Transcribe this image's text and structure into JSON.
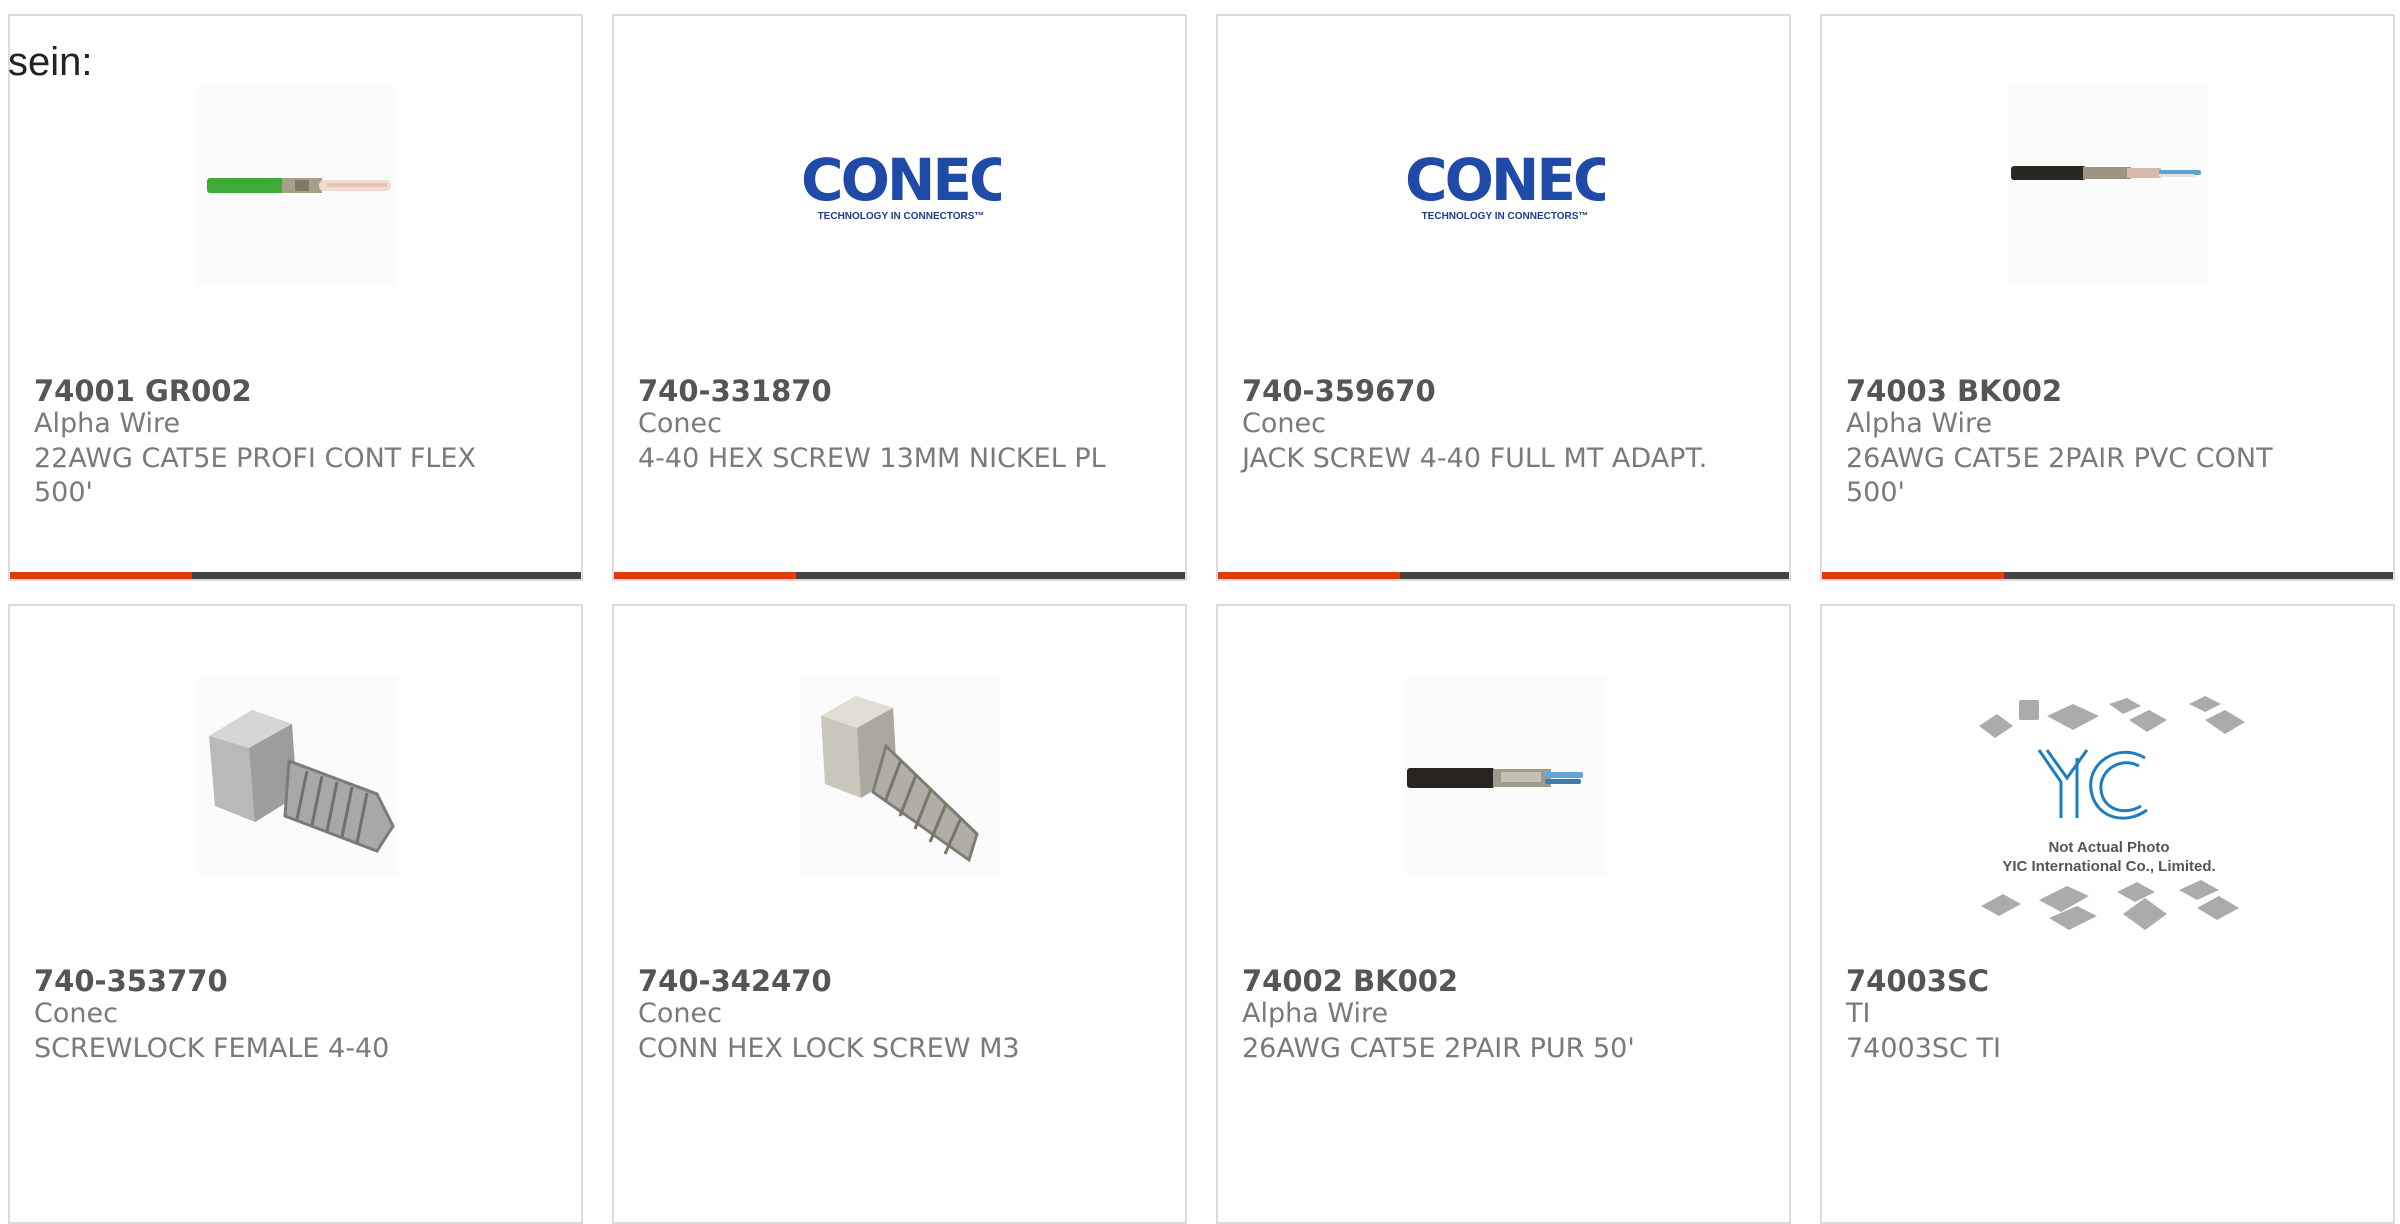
{
  "intro_text": "sein:",
  "products": [
    {
      "part": "74001 GR002",
      "maker": "Alpha Wire",
      "desc": "22AWG CAT5E PROFI CONT FLEX 500'",
      "image": "green-cable"
    },
    {
      "part": "740-331870",
      "maker": "Conec",
      "desc": "4-40 HEX SCREW 13MM NICKEL PL",
      "image": "conec-logo"
    },
    {
      "part": "740-359670",
      "maker": "Conec",
      "desc": "JACK SCREW 4-40 FULL MT ADAPT.",
      "image": "conec-logo"
    },
    {
      "part": "74003 BK002",
      "maker": "Alpha Wire",
      "desc": "26AWG CAT5E 2PAIR PVC CONT 500'",
      "image": "black-cable"
    },
    {
      "part": "740-353770",
      "maker": "Conec",
      "desc": "SCREWLOCK FEMALE 4-40",
      "image": "hex-screw"
    },
    {
      "part": "740-342470",
      "maker": "Conec",
      "desc": "CONN HEX LOCK SCREW M3",
      "image": "hex-screw-small"
    },
    {
      "part": "74002 BK002",
      "maker": "Alpha Wire",
      "desc": "26AWG CAT5E 2PAIR PUR 50'",
      "image": "black-cable-blue"
    },
    {
      "part": "74003SC",
      "maker": "TI",
      "desc": "74003SC TI",
      "image": "yic-placeholder"
    }
  ],
  "conec_logo": {
    "word": "CONEC",
    "tagline": "TECHNOLOGY IN CONNECTORS™"
  },
  "yic_placeholder": {
    "line1": "Not Actual Photo",
    "line2": "YIC International Co., Limited."
  },
  "colors": {
    "accent": "#e23c0e",
    "bar": "#444444",
    "conec_blue": "#1f4aa8",
    "text": "#7a7a7a"
  }
}
